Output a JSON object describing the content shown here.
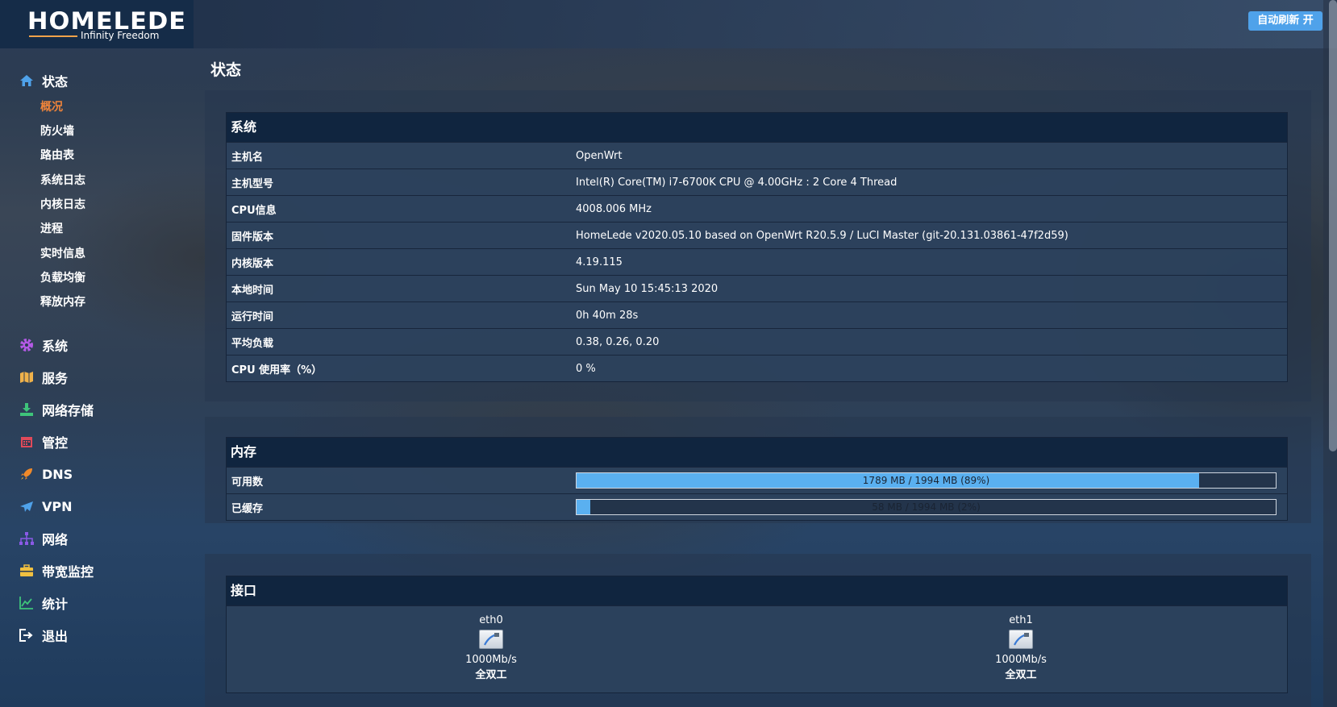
{
  "brand": {
    "name": "HOMELEDE",
    "tagline": "Infinity Freedom"
  },
  "header": {
    "refresh_button": "自动刷新 开"
  },
  "sidebar": {
    "items": [
      {
        "label": "状态",
        "icon": "home-icon",
        "color": "#4fa2ea",
        "children": [
          "概况",
          "防火墙",
          "路由表",
          "系统日志",
          "内核日志",
          "进程",
          "实时信息",
          "负载均衡",
          "释放内存"
        ],
        "active_child": "概况"
      },
      {
        "label": "系统",
        "icon": "gear-icon",
        "color": "#b45ae6"
      },
      {
        "label": "服务",
        "icon": "map-icon",
        "color": "#f0b24a"
      },
      {
        "label": "网络存储",
        "icon": "download-icon",
        "color": "#3ec47a"
      },
      {
        "label": "管控",
        "icon": "calendar-icon",
        "color": "#e04a5a"
      },
      {
        "label": "DNS",
        "icon": "rocket-icon",
        "color": "#f08a2a"
      },
      {
        "label": "VPN",
        "icon": "plane-icon",
        "color": "#4fa2ea"
      },
      {
        "label": "网络",
        "icon": "sitemap-icon",
        "color": "#8a5ae6"
      },
      {
        "label": "带宽监控",
        "icon": "briefcase-icon",
        "color": "#f0c040"
      },
      {
        "label": "统计",
        "icon": "line-chart-icon",
        "color": "#3ec47a"
      },
      {
        "label": "退出",
        "icon": "logout-icon",
        "color": "#ffffff"
      }
    ]
  },
  "page": {
    "title": "状态"
  },
  "system": {
    "heading": "系统",
    "rows": [
      {
        "key": "主机名",
        "value": "OpenWrt"
      },
      {
        "key": "主机型号",
        "value": "Intel(R) Core(TM) i7-6700K CPU @ 4.00GHz : 2 Core 4 Thread"
      },
      {
        "key": "CPU信息",
        "value": "4008.006 MHz"
      },
      {
        "key": "固件版本",
        "value": "HomeLede v2020.05.10 based on OpenWrt R20.5.9 / LuCI Master (git-20.131.03861-47f2d59)"
      },
      {
        "key": "内核版本",
        "value": "4.19.115"
      },
      {
        "key": "本地时间",
        "value": "Sun May 10 15:45:13 2020"
      },
      {
        "key": "运行时间",
        "value": "0h 40m 28s"
      },
      {
        "key": "平均负载",
        "value": "0.38, 0.26, 0.20"
      },
      {
        "key": "CPU 使用率（%）",
        "value": "0 %"
      }
    ]
  },
  "memory": {
    "heading": "内存",
    "rows": [
      {
        "key": "可用数",
        "text": "1789 MB / 1994 MB (89%)",
        "fraction": 0.89
      },
      {
        "key": "已缓存",
        "text": "58 MB / 1994 MB (2%)",
        "fraction": 0.02
      }
    ]
  },
  "interfaces": {
    "heading": "接口",
    "items": [
      {
        "name": "eth0",
        "speed": "1000Mb/s",
        "duplex": "全双工"
      },
      {
        "name": "eth1",
        "speed": "1000Mb/s",
        "duplex": "全双工"
      }
    ]
  }
}
